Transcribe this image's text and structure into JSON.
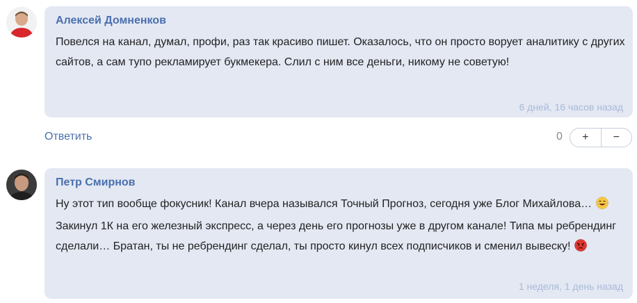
{
  "comments": [
    {
      "author": "Алексей Домненков",
      "text": "Повелся на канал, думал, профи, раз так красиво пишет. Оказалось, что он просто ворует аналитику с других сайтов, а сам тупо рекламирует букмекера. Слил с ним все деньги, никому не советую!",
      "time": "6 дней, 16 часов назад"
    },
    {
      "author": "Петр Смирнов",
      "text_part1": "Ну этот тип вообще фокусник! Канал вчера назывался Точный Прогноз, сегодня уже Блог Михайлова…",
      "text_part2": "Закинул 1К на его железный экспресс, а через день его прогнозы уже в другом канале! Типа мы ребрендинг сделали… Братан, ты не ребрендинг сделал, ты просто кинул всех подписчиков и сменил вывеску!",
      "time": "1 неделя, 1 день назад"
    }
  ],
  "actions": {
    "reply_label": "Ответить",
    "vote_count": "0",
    "upvote_label": "+",
    "downvote_label": "−"
  },
  "icons": [
    "laughing-emoji-icon",
    "angry-emoji-icon"
  ],
  "colors": {
    "bubble": "#e3e8f3",
    "author": "#4a6fae",
    "time": "#a9bad8"
  }
}
